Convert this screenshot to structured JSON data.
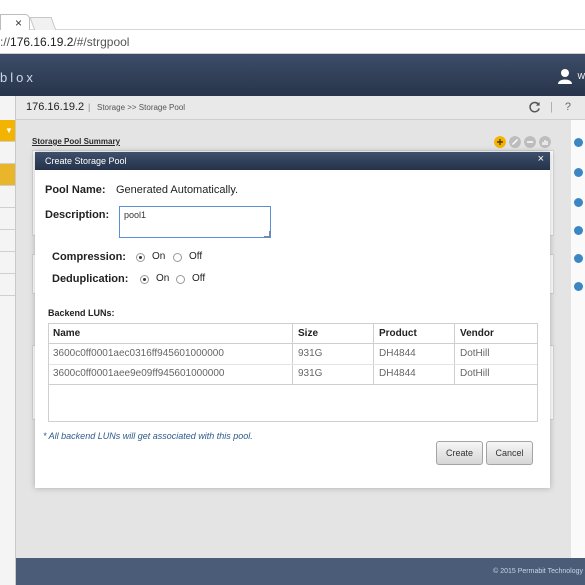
{
  "browser": {
    "tab_close": "×",
    "url_prefix": "://",
    "url_host": "176.16.19.2",
    "url_path": "/#/strgpool"
  },
  "header": {
    "brand": "blox",
    "user_initial": "W"
  },
  "breadcrumb": {
    "ip": "176.16.19.2",
    "separator": "|",
    "path": "Storage >> Storage Pool",
    "toolbar_separator": "|",
    "help": "?"
  },
  "main": {
    "summary_title": "Storage Pool Summary"
  },
  "modal": {
    "title": "Create Storage Pool",
    "close": "×",
    "pool_name_label": "Pool Name:",
    "pool_name_value": "Generated Automatically.",
    "description_label": "Description:",
    "description_value": "pool1",
    "compression_label": "Compression:",
    "compression_on": "On",
    "compression_off": "Off",
    "compression_selected": "On",
    "dedup_label": "Deduplication:",
    "dedup_on": "On",
    "dedup_off": "Off",
    "dedup_selected": "On",
    "luns_label": "Backend LUNs:",
    "lun_columns": [
      "Name",
      "Size",
      "Product",
      "Vendor"
    ],
    "luns": [
      {
        "name": "3600c0ff0001aec0316ff945601000000",
        "size": "931G",
        "product": "DH4844",
        "vendor": "DotHill"
      },
      {
        "name": "3600c0ff0001aee9e09ff945601000000",
        "size": "931G",
        "product": "DH4844",
        "vendor": "DotHill"
      }
    ],
    "note": "* All backend LUNs will get associated with this pool.",
    "create_label": "Create",
    "cancel_label": "Cancel"
  },
  "footer": {
    "copyright": "© 2015 Permabit Technology"
  },
  "colors": {
    "header_bg": "#2e3c55",
    "accent": "#f2b400",
    "link_blue": "#3b86c4"
  }
}
